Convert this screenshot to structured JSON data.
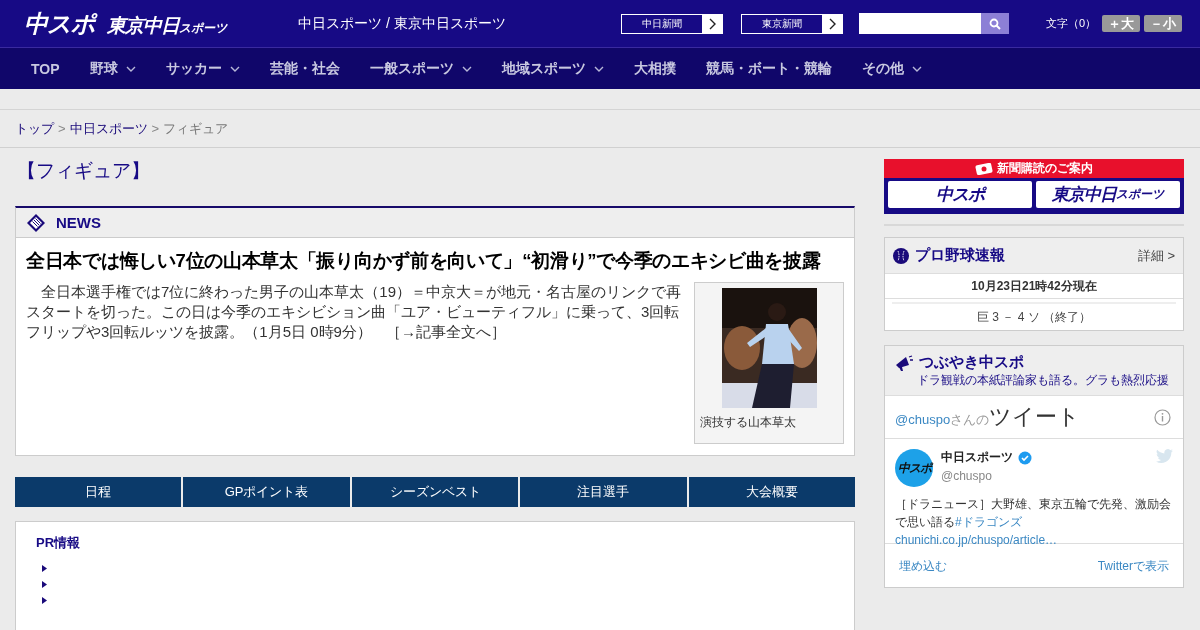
{
  "header": {
    "logo_main": "中スポ",
    "logo_sub": "東京中日",
    "logo_sub_small": "スポーツ",
    "site_title": "中日スポーツ / 東京中日スポーツ",
    "links": [
      {
        "label": "中日新聞"
      },
      {
        "label": "東京新聞"
      }
    ],
    "font_label": "文字（0）",
    "font_buttons": [
      {
        "label": "＋大"
      },
      {
        "label": "－小"
      }
    ]
  },
  "nav": [
    {
      "label": "TOP",
      "dropdown": false
    },
    {
      "label": "野球",
      "dropdown": true
    },
    {
      "label": "サッカー",
      "dropdown": true
    },
    {
      "label": "芸能・社会",
      "dropdown": false
    },
    {
      "label": "一般スポーツ",
      "dropdown": true
    },
    {
      "label": "地域スポーツ",
      "dropdown": true
    },
    {
      "label": "大相撲",
      "dropdown": false
    },
    {
      "label": "競馬・ボート・競輪",
      "dropdown": false
    },
    {
      "label": "その他",
      "dropdown": true
    }
  ],
  "breadcrumb": {
    "separator": ">",
    "items": [
      {
        "label": "トップ",
        "link": true
      },
      {
        "label": "中日スポーツ",
        "link": true
      },
      {
        "label": "フィギュア",
        "link": false
      }
    ]
  },
  "page_title": "【フィギュア】",
  "news": {
    "section": "NEWS",
    "headline": "全日本では悔しい7位の山本草太「振り向かず前を向いて」“初滑り”で今季のエキシビ曲を披露",
    "body": "全日本選手権では7位に終わった男子の山本草太（19）＝中京大＝が地元・名古屋のリンクで再スタートを切った。この日は今季のエキシビション曲「ユア・ビューティフル」に乗って、3回転フリップや3回転ルッツを披露。（1月5日 0時9分）",
    "more": "［→記事全文へ］",
    "photo": {
      "kind": "picture",
      "caption": "演技する山本草太"
    }
  },
  "tabs": [
    {
      "label": "日程"
    },
    {
      "label": "GPポイント表"
    },
    {
      "label": "シーズンベスト"
    },
    {
      "label": "注目選手"
    },
    {
      "label": "大会概要"
    }
  ],
  "pr": {
    "title": "PR情報",
    "items": [
      {
        "kind": "link"
      },
      {
        "kind": "link"
      },
      {
        "kind": "link"
      }
    ]
  },
  "sidebar": {
    "subscribe": {
      "title": "新聞購読のご案内",
      "logos": [
        {
          "main": "中スポ"
        },
        {
          "main": "東京中日",
          "small": "スポーツ"
        }
      ]
    },
    "baseball": {
      "title": "プロ野球速報",
      "detail": "詳細 >",
      "time": "10月23日21時42分現在",
      "score": "巨 3 － 4 ソ （終了）"
    },
    "tweets": {
      "title": "つぶやき中スポ",
      "subtitle": "ドラ観戦の本紙評論家も語る。グラも熱烈応援",
      "handle": "@chuspo",
      "handle_suffix": "さんの",
      "heading": "ツイート",
      "author": "中日スポーツ",
      "verified": true,
      "author_handle": "@chuspo",
      "avatar_text": "中スポ",
      "text": "［ドラニュース］大野雄、東京五輪で先発、激励会で思い語る",
      "hashtag": "#ドラゴンズ",
      "url": "chunichi.co.jp/chuspo/article…",
      "embed": "埋め込む",
      "view": "Twitterで表示"
    }
  }
}
